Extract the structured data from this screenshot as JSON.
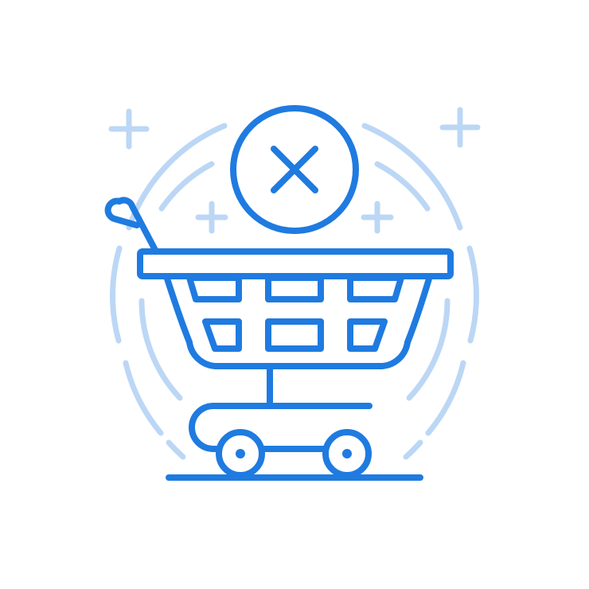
{
  "illustration": {
    "subject": "shopping-cart-cancel-icon",
    "colors": {
      "primary": "#1f7be0",
      "accent_light": "#bcd7f5",
      "background": "#ffffff"
    },
    "icons": [
      "shopping-cart-icon",
      "close-circle-icon",
      "sparkle-plus-icon",
      "radiating-arc-icon"
    ]
  }
}
